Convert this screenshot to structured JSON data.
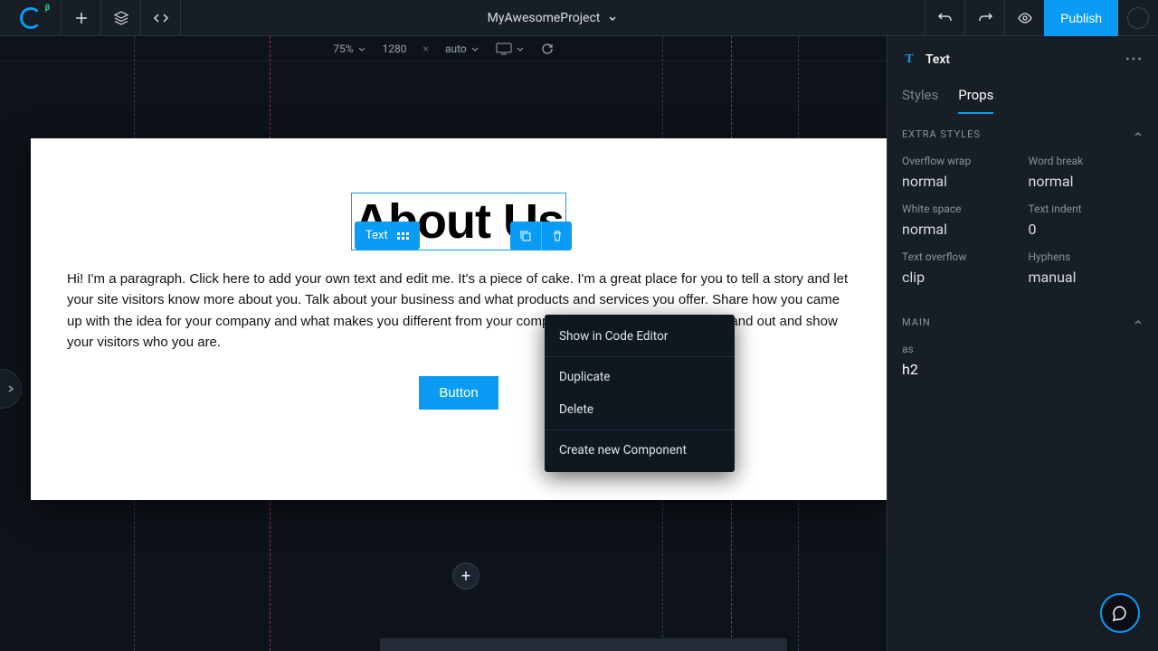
{
  "topbar": {
    "project_name": "MyAwesomeProject",
    "publish_label": "Publish"
  },
  "subbar": {
    "zoom": "75%",
    "width": "1280",
    "sep": "×",
    "height": "auto"
  },
  "canvas": {
    "selected_label": "Text",
    "heading": "About Us",
    "paragraph": "Hi! I'm a paragraph. Click here to add your own text and edit me. It's a piece of cake. I'm a great place for you to tell a story and let your site visitors know more about you. Talk about your business and what products and services you offer. Share how you came up with the idea for your company and what makes you different from your competitors. Make your company stand out and show your visitors who you are.",
    "button_label": "Button"
  },
  "context_menu": {
    "item_show": "Show in Code Editor",
    "item_duplicate": "Duplicate",
    "item_delete": "Delete",
    "item_create": "Create new Component"
  },
  "panel": {
    "title": "Text",
    "tabs": {
      "styles": "Styles",
      "props": "Props"
    },
    "section_extra": "EXTRA STYLES",
    "fields": {
      "overflow_wrap": {
        "label": "Overflow wrap",
        "value": "normal"
      },
      "word_break": {
        "label": "Word break",
        "value": "normal"
      },
      "white_space": {
        "label": "White space",
        "value": "normal"
      },
      "text_indent": {
        "label": "Text indent",
        "value": "0"
      },
      "text_overflow": {
        "label": "Text overflow",
        "value": "clip"
      },
      "hyphens": {
        "label": "Hyphens",
        "value": "manual"
      }
    },
    "section_main": "MAIN",
    "main_field": {
      "label": "as",
      "value": "h2"
    }
  }
}
